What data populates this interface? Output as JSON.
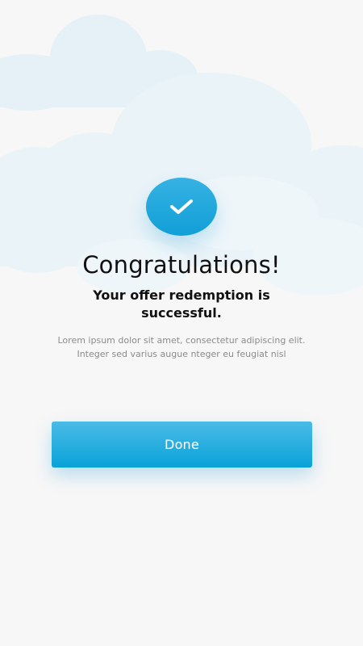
{
  "success_dialog": {
    "title": "Congratulations!",
    "subtitle": "Your offer redemption is successful.",
    "description": "Lorem ipsum dolor sit amet, consectetur adipiscing elit. Integer sed varius augue nteger eu feugiat nisl",
    "badge_icon": "checkmark-icon",
    "done_label": "Done"
  },
  "colors": {
    "accent": "#119fd7",
    "background": "#f7f7f7",
    "cloud": "#e6f1f7"
  }
}
